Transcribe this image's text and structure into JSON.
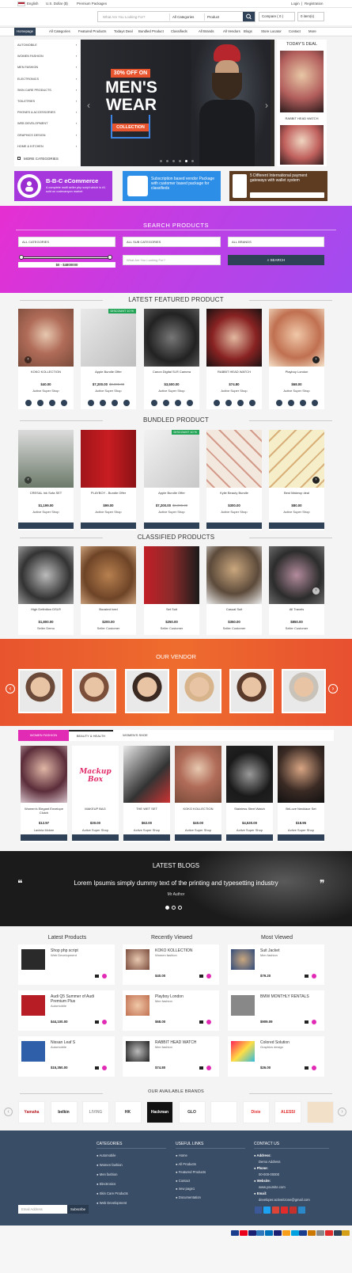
{
  "topbar": {
    "lang": "English",
    "currency": "U.S. Dollar ($)",
    "premium": "Premium Packages",
    "login": "Login",
    "sep": "|",
    "register": "Registration"
  },
  "header": {
    "search_placeholder": "What Are You Looking For?",
    "category": "All Categories",
    "type": "Product",
    "compare": "Compare ( 0 )",
    "cart": "0 item(s)"
  },
  "nav": [
    "Homepage",
    "All Categories",
    "Featured Products",
    "Todays Deal",
    "Bundled Product",
    "Classifieds",
    "All Brands",
    "All Vendors",
    "Blogs",
    "Store Locator",
    "Contact",
    "More"
  ],
  "categories": [
    "AUTOMOBILE",
    "WOMEN FASHION",
    "MEN FASHION",
    "ELECTRONICS",
    "SKIN CARE PRODUCTS",
    "TOILETRIES",
    "PHONES & ACCESSORIES",
    "WEB DEVELOPMENT",
    "GRAPHICS DESIGN",
    "HOME & KITCHEN"
  ],
  "more_categories": "MORE CATEGORIES",
  "banner": {
    "offer": "30% OFF ON",
    "line1": "MEN'S",
    "line2": "WEAR",
    "collection": "COLLECTION"
  },
  "deal": {
    "title": "TODAY'S DEAL",
    "item": "RABBIT HEAD WATCH"
  },
  "promos": [
    {
      "title": "B-B-C eCommerce",
      "sub": "A complete multi seller php script which is #1 sold on codecanyon market"
    },
    {
      "title": "Subscription based vendor Package with customer based package for classifieds"
    },
    {
      "title": "5 Different International payment gateways with wallet system"
    }
  ],
  "search_products": {
    "title": "SEARCH PRODUCTS",
    "cat": "ALL CATEGORIES",
    "subcat": "ALL SUB CATEGORIES",
    "brand": "ALL BRANDS",
    "range": "$0 - $4800000",
    "placeholder": "What Are You Looking For?",
    "button": "SEARCH"
  },
  "featured": {
    "title": "LATEST FEATURED PRODUCT",
    "items": [
      {
        "name": "KOKO KOLLECTION",
        "price": "$40.00",
        "old": "",
        "seller": "Active Super Shop",
        "discount": ""
      },
      {
        "name": "Apple Bundle Offer",
        "price": "$7,200.00",
        "old": "$8,000.00",
        "seller": "Active Super Shop",
        "discount": "DISCOUNT 10 %"
      },
      {
        "name": "Canon Digital SLR Camera",
        "price": "$3,500.00",
        "old": "",
        "seller": "Active Super Shop",
        "discount": ""
      },
      {
        "name": "RABBIT HEAD WATCH",
        "price": "$74.80",
        "old": "",
        "seller": "Active Super Shop",
        "discount": ""
      },
      {
        "name": "Playboy London",
        "price": "$68.00",
        "old": "",
        "seller": "Active Super Shop",
        "discount": ""
      }
    ]
  },
  "bundled": {
    "title": "BUNDLED PRODUCT",
    "items": [
      {
        "name": "CRESAL Ink Sofa SET",
        "price": "$1,199.00",
        "old": "",
        "seller": "Active Super Shop",
        "discount": ""
      },
      {
        "name": "PLAYBOY - Bundle Offer",
        "price": "$99.00",
        "old": "",
        "seller": "Active Super Shop",
        "discount": ""
      },
      {
        "name": "Apple Bundle Offer",
        "price": "$7,200.00",
        "old": "$8,000.00",
        "seller": "Active Super Shop",
        "discount": "DISCOUNT 10 %"
      },
      {
        "name": "Kylie Beauty Bundle",
        "price": "$300.00",
        "old": "",
        "seller": "Active Super Shop",
        "discount": ""
      },
      {
        "name": "Best Makeup deal",
        "price": "$80.00",
        "old": "",
        "seller": "Active Super Shop",
        "discount": ""
      }
    ]
  },
  "classified": {
    "title": "CLASSIFIED PRODUCTS",
    "items": [
      {
        "name": "High Definition DSLR",
        "price": "$1,800.00",
        "seller": "Seller Demo"
      },
      {
        "name": "Boosted heel",
        "price": "$200.00",
        "seller": "Seller Customer"
      },
      {
        "name": "Set Suit",
        "price": "$250.00",
        "seller": "Seller Customer"
      },
      {
        "name": "Casual Suit",
        "price": "$350.00",
        "seller": "Seller Customer"
      },
      {
        "name": "All Travels",
        "price": "$850.00",
        "seller": "Seller Customer"
      }
    ]
  },
  "vendor": {
    "title": "OUR VENDOR"
  },
  "tabs": [
    "WOMEN FASHION",
    "BEAUTY & HEALTH",
    "WOMEN'S SHOE"
  ],
  "tabitems": [
    {
      "name": "Women's Elegant Envelope Clutch",
      "price": "$12.97",
      "seller": "Lavinia Mckee"
    },
    {
      "name": "MAKEUP BAG",
      "price": "$30.00",
      "seller": "Active Super Shop"
    },
    {
      "name": "THE WET SET",
      "price": "$62.00",
      "seller": "Active Super Shop"
    },
    {
      "name": "KOKO KOLLECTION",
      "price": "$40.00",
      "seller": "Active Super Shop"
    },
    {
      "name": "Stainless Steel Watch",
      "price": "$4,530.00",
      "seller": "Active Super Shop"
    },
    {
      "name": "BriLove Necklace Set",
      "price": "$18.95",
      "seller": "Active Super Shop"
    }
  ],
  "makeup_box": "Mackup Box",
  "blogs": {
    "title": "LATEST BLOGS",
    "quote": "Lorem Ipsumis simply dummy text of the printing and typesetting industry",
    "author": "Mr Author"
  },
  "lists": [
    {
      "title": "Latest Products",
      "items": [
        {
          "name": "Shop php script",
          "cat": "Web Development",
          "price": ""
        },
        {
          "name": "Audi Q5 Summer of Audi Premium Plus",
          "cat": "Automobile",
          "price": "$44,100.00"
        },
        {
          "name": "Nissan Leaf S",
          "cat": "Automobile",
          "price": "$15,350.00"
        }
      ]
    },
    {
      "title": "Recently Viewed",
      "items": [
        {
          "name": "KOKO KOLLECTION",
          "cat": "Women fashion",
          "price": "$40.00"
        },
        {
          "name": "Playboy London",
          "cat": "Men fashion",
          "price": "$68.00"
        },
        {
          "name": "RABBIT HEAD WATCH",
          "cat": "Men fashion",
          "price": "$74.80"
        }
      ]
    },
    {
      "title": "Most Viewed",
      "items": [
        {
          "name": "Suit Jacket",
          "cat": "Men fashion",
          "price": "$79.20"
        },
        {
          "name": "BMW MONTHLY RENTALS",
          "cat": "",
          "price": "$909.09"
        },
        {
          "name": "Colored Solution",
          "cat": "Graphics design",
          "price": "$26.00"
        }
      ]
    }
  ],
  "brands": {
    "title": "OUR AVAILABLE BRANDS",
    "items": [
      "Yamaha",
      "belkin",
      "LIVING",
      "HK",
      "Hackman",
      "GLO",
      "",
      "Dixie",
      "ALESSI",
      ""
    ]
  },
  "footer": {
    "categories_title": "CATEGORIES",
    "categories": [
      "Automobile",
      "Women fashion",
      "Men fashion",
      "Electronics",
      "Skin Care Products",
      "Web Development"
    ],
    "links_title": "USEFUL LINKS",
    "links": [
      "Home",
      "All Products",
      "Featured Products",
      "Contact",
      "new page1",
      "Documentation"
    ],
    "contact_title": "CONTACT US",
    "address_label": "Address:",
    "address": "Demo Address",
    "phone_label": "Phone:",
    "phone": "00-000-00000",
    "website_label": "Website:",
    "website": "www.yoursite.com",
    "email_label": "Email:",
    "email": "developer.activeitzone@gmail.com",
    "newsletter_placeholder": "Email Address",
    "subscribe": "Subscribe"
  },
  "colors": {
    "navy": "#2f4157",
    "pink": "#e22bb5",
    "purple": "#a14cf0",
    "orange": "#ee6c2d",
    "green": "#23a456"
  }
}
